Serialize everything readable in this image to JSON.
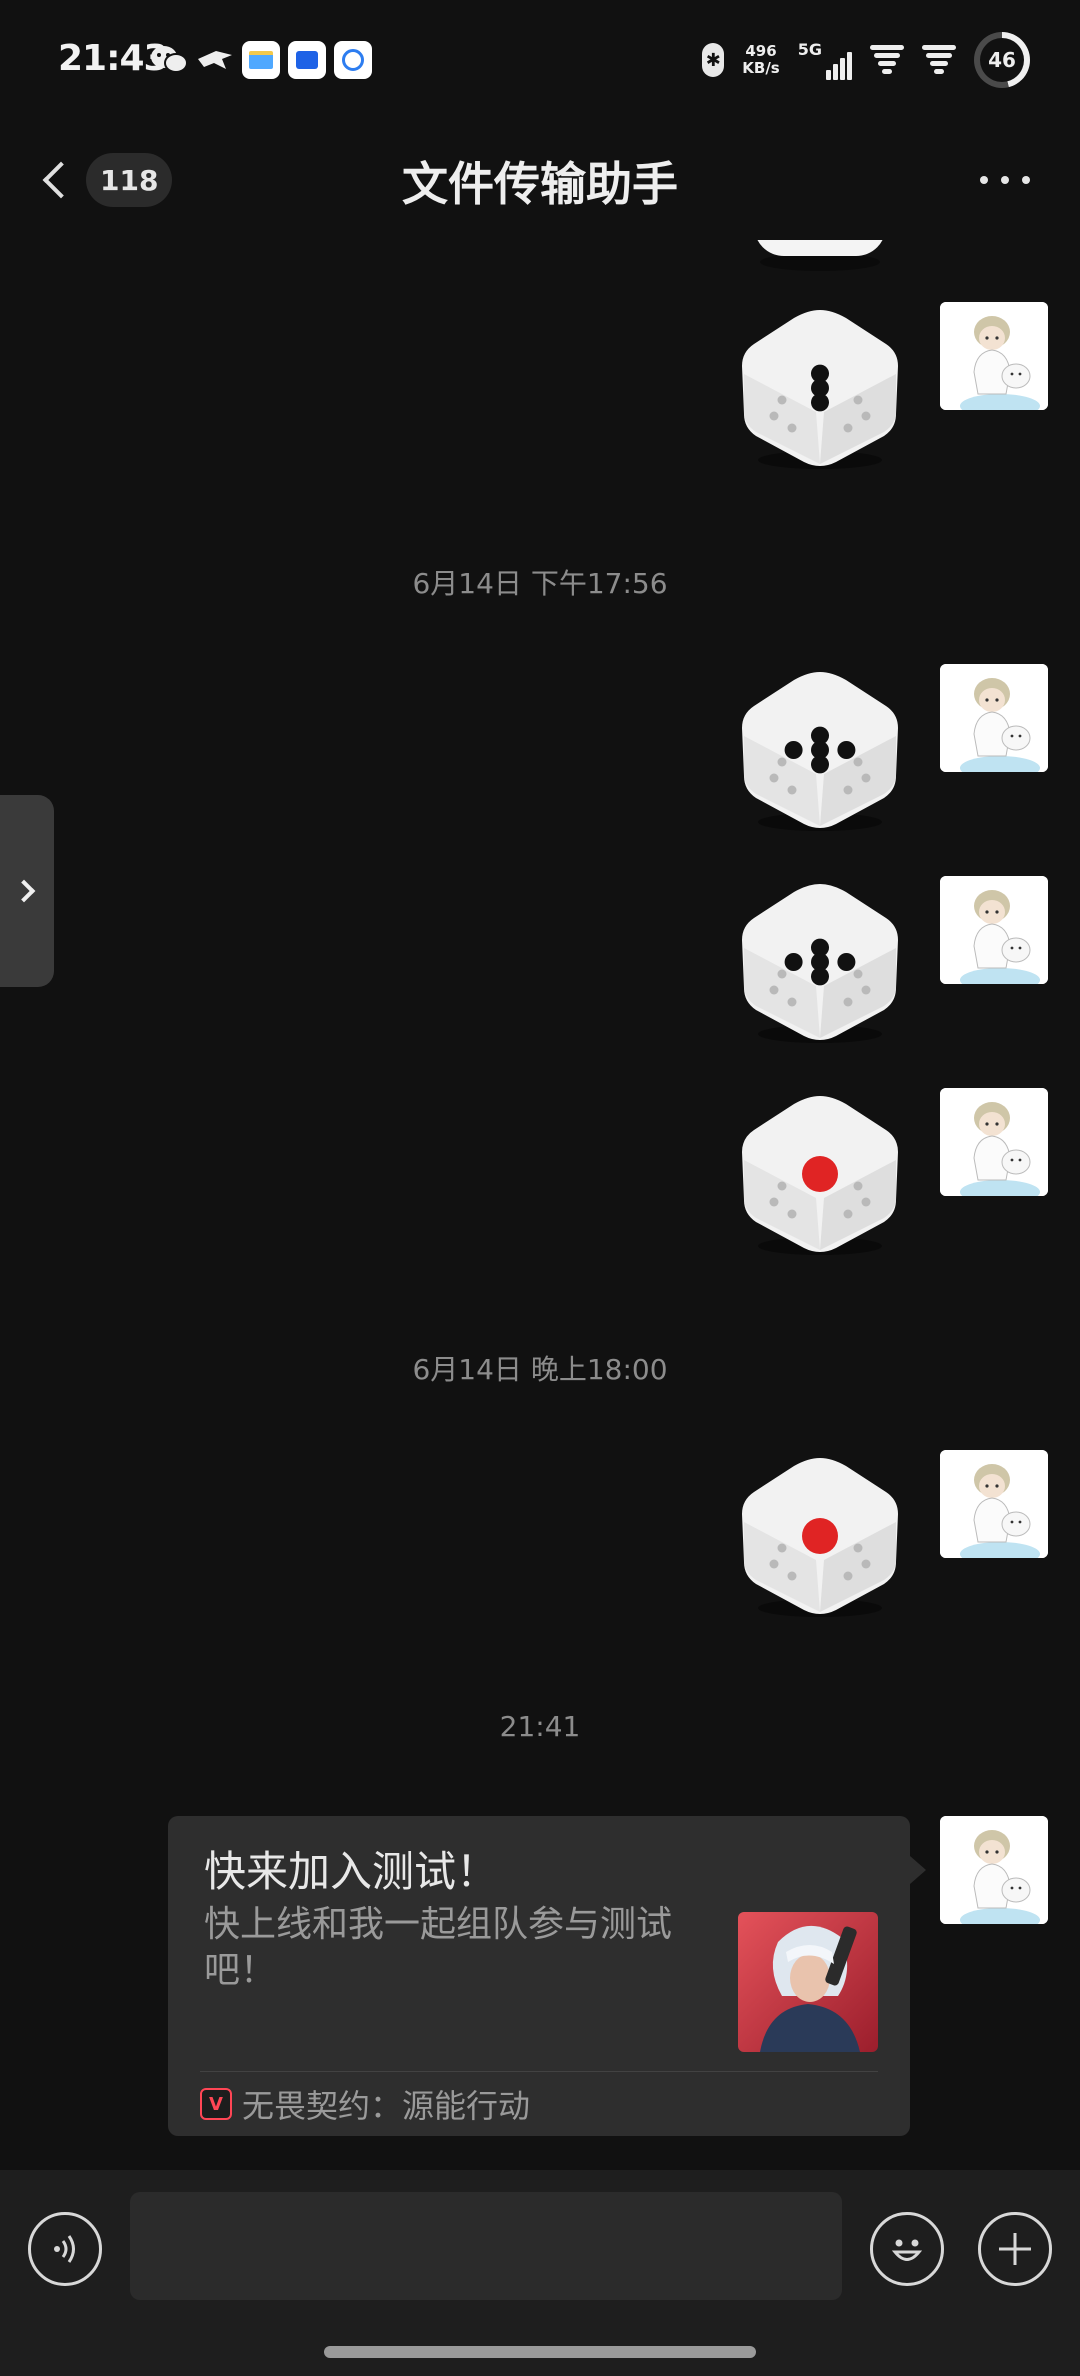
{
  "status_bar": {
    "time": "21:43",
    "network_speed_value": "496",
    "network_speed_unit": "KB/s",
    "network_type": "5G",
    "battery_percent": "46"
  },
  "header": {
    "unread_count": "118",
    "title": "文件传输助手"
  },
  "messages": {
    "timestamps": [
      "6月14日 下午17:56",
      "6月14日 晚上18:00",
      "21:41"
    ],
    "dice_values": [
      3,
      5,
      5,
      1,
      1
    ]
  },
  "share_card": {
    "title": "快来加入测试！",
    "description": "快上线和我一起组队参与测试吧！",
    "source_name": "无畏契约：源能行动"
  },
  "input": {
    "value": "",
    "placeholder": ""
  },
  "colors": {
    "background": "#111111",
    "input_bar": "#1e1e1e",
    "card": "#2e2e2e",
    "pip_black": "#111111",
    "pip_red": "#e02424"
  }
}
